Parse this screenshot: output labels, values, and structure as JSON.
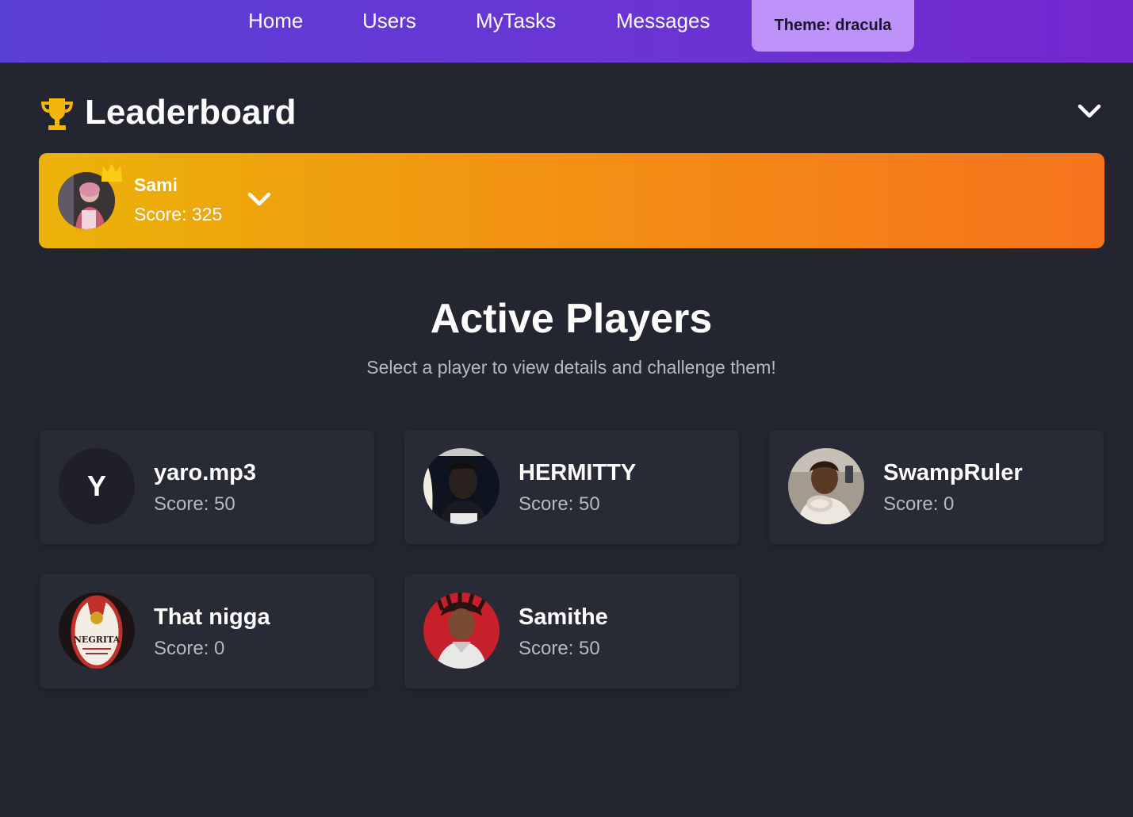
{
  "nav": {
    "links": [
      "Home",
      "Users",
      "MyTasks",
      "Messages"
    ],
    "theme_label": "Theme: dracula"
  },
  "leaderboard": {
    "title": "Leaderboard",
    "top_player": {
      "name": "Sami",
      "score": "Score: 325"
    }
  },
  "active_players": {
    "title": "Active Players",
    "subtitle": "Select a player to view details and challenge them!",
    "players": [
      {
        "name": "yaro.mp3",
        "score": "Score: 50",
        "initial": "Y"
      },
      {
        "name": "HERMITTY",
        "score": "Score: 50"
      },
      {
        "name": "SwampRuler",
        "score": "Score: 0"
      },
      {
        "name": "That nigga",
        "score": "Score: 0",
        "avatar_text": "NEGRITA"
      },
      {
        "name": "Samithe",
        "score": "Score: 50"
      }
    ]
  },
  "colors": {
    "background": "#232631",
    "card": "#282a36",
    "accent": "#bd93f9",
    "leader_gradient_start": "#eab308",
    "leader_gradient_end": "#f7731d"
  }
}
